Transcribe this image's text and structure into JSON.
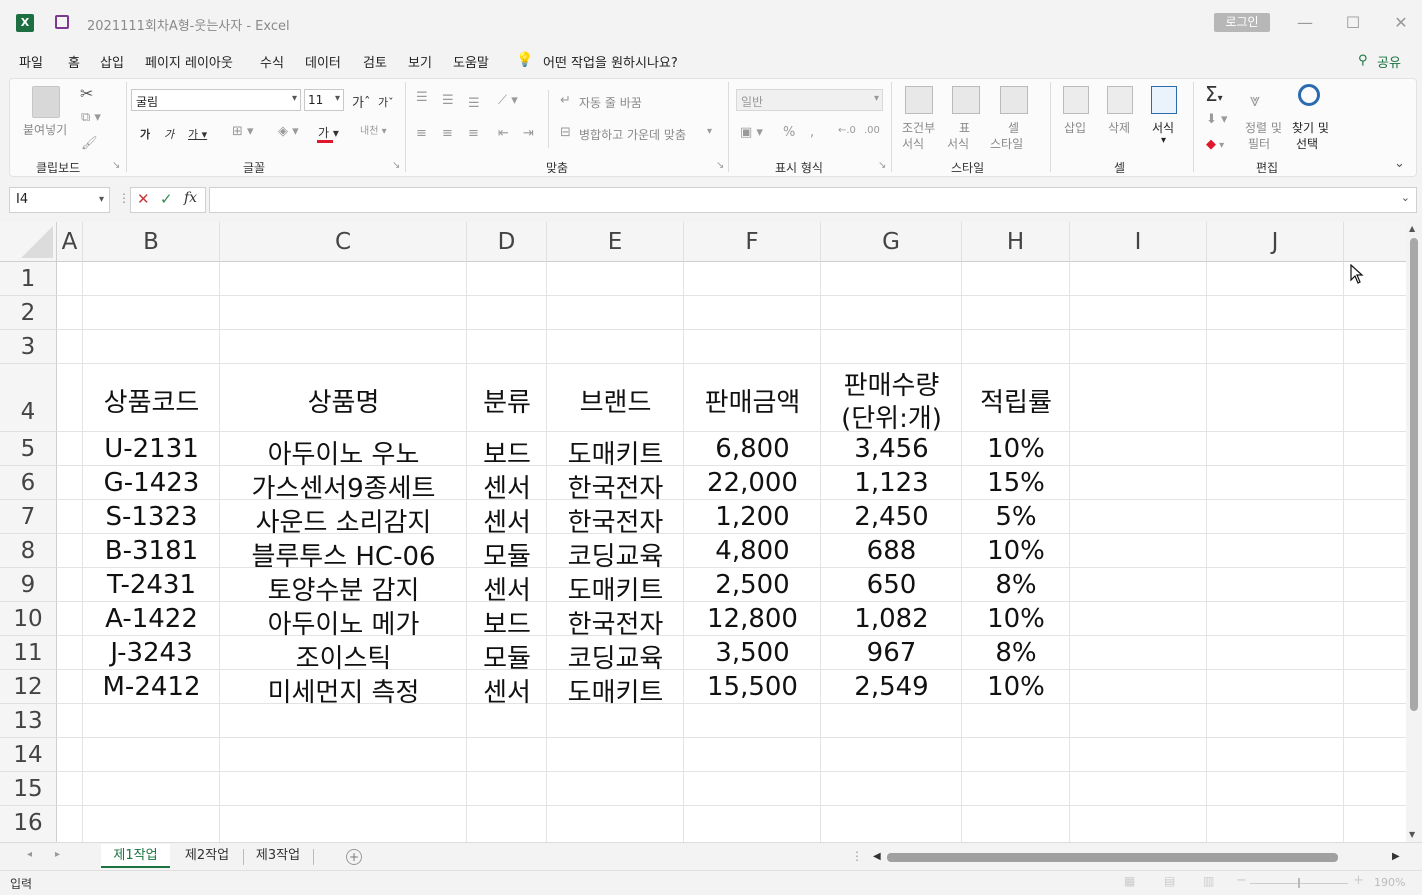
{
  "title": "2021111회차A형-웃는사자  -  Excel",
  "login": "로그인",
  "menu": [
    "파일",
    "홈",
    "삽입",
    "페이지 레이아웃",
    "수식",
    "데이터",
    "검토",
    "보기",
    "도움말"
  ],
  "tell_me": "어떤 작업을 원하시나요?",
  "share": "공유",
  "ribbon": {
    "paste": "붙여넣기",
    "clipboard": "클립보드",
    "font_name": "굴림",
    "font_size": "11",
    "font_grp": "글꼴",
    "wrap": "자동 줄 바꿈",
    "merge": "병합하고 가운데 맞춤",
    "align_grp": "맞춤",
    "num_format": "일반",
    "num_grp": "표시 형식",
    "cond_a": "조건부",
    "cond_b": "서식",
    "table_a": "표",
    "table_b": "서식",
    "cellstyle_a": "셀",
    "cellstyle_b": "스타일",
    "style_grp": "스타일",
    "insert": "삽입",
    "delete": "삭제",
    "format": "서식",
    "cell_grp": "셀",
    "sort_a": "정렬 및",
    "sort_b": "필터",
    "find_a": "찾기 및",
    "find_b": "선택",
    "edit_grp": "편집"
  },
  "name_box": "I4",
  "formula": "",
  "columns": [
    "A",
    "B",
    "C",
    "D",
    "E",
    "F",
    "G",
    "H",
    "I",
    "J"
  ],
  "rows": [
    "1",
    "2",
    "3",
    "4",
    "5",
    "6",
    "7",
    "8",
    "9",
    "10",
    "11",
    "12",
    "13",
    "14",
    "15",
    "16"
  ],
  "table": {
    "header": [
      "상품코드",
      "상품명",
      "분류",
      "브랜드",
      "판매금액",
      "판매수량",
      "(단위:개)",
      "적립률"
    ],
    "rows": [
      [
        "U-2131",
        "아두이노 우노",
        "보드",
        "도매키트",
        "6,800",
        "3,456",
        "10%"
      ],
      [
        "G-1423",
        "가스센서9종세트",
        "센서",
        "한국전자",
        "22,000",
        "1,123",
        "15%"
      ],
      [
        "S-1323",
        "사운드 소리감지",
        "센서",
        "한국전자",
        "1,200",
        "2,450",
        "5%"
      ],
      [
        "B-3181",
        "블루투스 HC-06",
        "모듈",
        "코딩교육",
        "4,800",
        "688",
        "10%"
      ],
      [
        "T-2431",
        "토양수분 감지",
        "센서",
        "도매키트",
        "2,500",
        "650",
        "8%"
      ],
      [
        "A-1422",
        "아두이노 메가",
        "보드",
        "한국전자",
        "12,800",
        "1,082",
        "10%"
      ],
      [
        "J-3243",
        "조이스틱",
        "모듈",
        "코딩교육",
        "3,500",
        "967",
        "8%"
      ],
      [
        "M-2412",
        "미세먼지 측정",
        "센서",
        "도매키트",
        "15,500",
        "2,549",
        "10%"
      ]
    ]
  },
  "sheets": [
    "제1작업",
    "제2작업",
    "제3작업"
  ],
  "status": "입력",
  "zoom": "190%"
}
